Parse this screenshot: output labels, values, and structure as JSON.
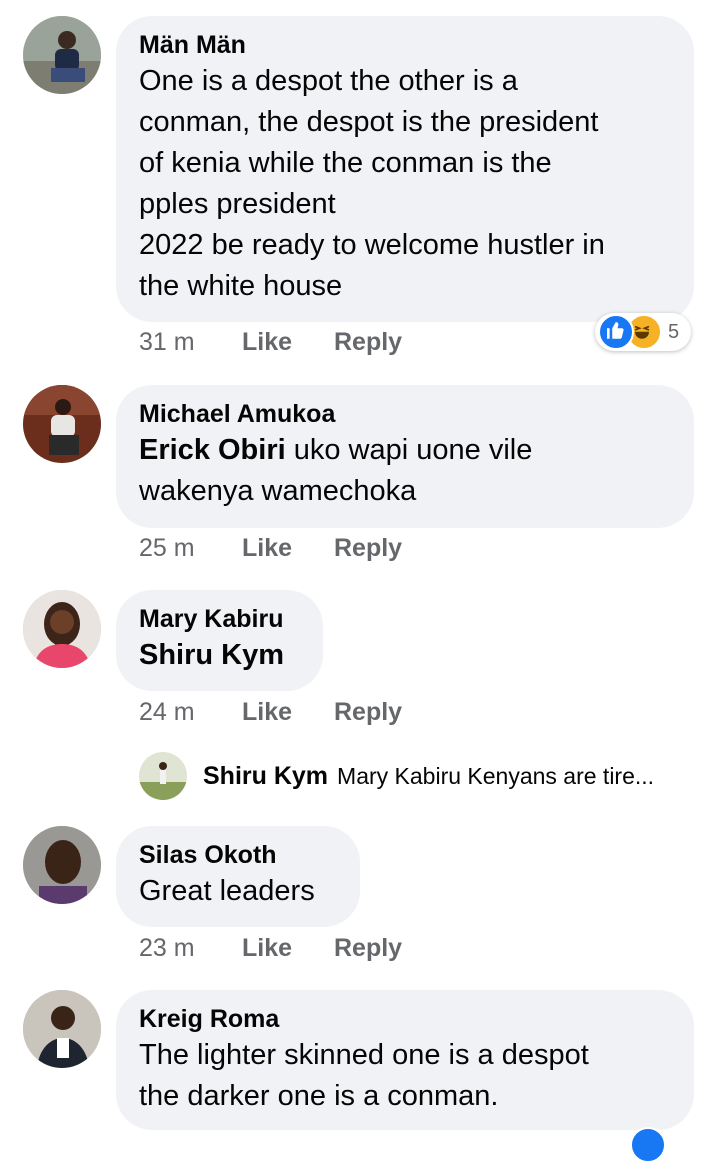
{
  "comments": [
    {
      "author": "Män Män",
      "text": "One is a despot the other is a\nconman, the despot is the president\nof kenia while the conman is the\npples president\n2022 be ready to welcome hustler in\nthe white house",
      "time": "31 m",
      "like": "Like",
      "reply": "Reply",
      "reactions": {
        "icons": [
          "like-icon",
          "haha-icon"
        ],
        "count": "5"
      }
    },
    {
      "author": "Michael Amukoa",
      "mention": "Erick Obiri",
      "text": " uko wapi uone vile\nwakenya wamechoka",
      "time": "25 m",
      "like": "Like",
      "reply": "Reply"
    },
    {
      "author": "Mary Kabiru",
      "mention": "Shiru Kym",
      "time": "24 m",
      "like": "Like",
      "reply": "Reply",
      "reply_preview": {
        "author": "Shiru Kym",
        "text": "Mary Kabiru Kenyans are tire..."
      }
    },
    {
      "author": "Silas Okoth",
      "text": "Great leaders",
      "time": "23 m",
      "like": "Like",
      "reply": "Reply"
    },
    {
      "author": "Kreig Roma",
      "text": "The lighter skinned one is a despot\nthe darker one is a conman."
    }
  ],
  "colors": {
    "bubble_bg": "#f0f2f5",
    "meta_text": "#65676b",
    "like_blue": "#1877f2",
    "haha_yellow": "#f7b125"
  }
}
